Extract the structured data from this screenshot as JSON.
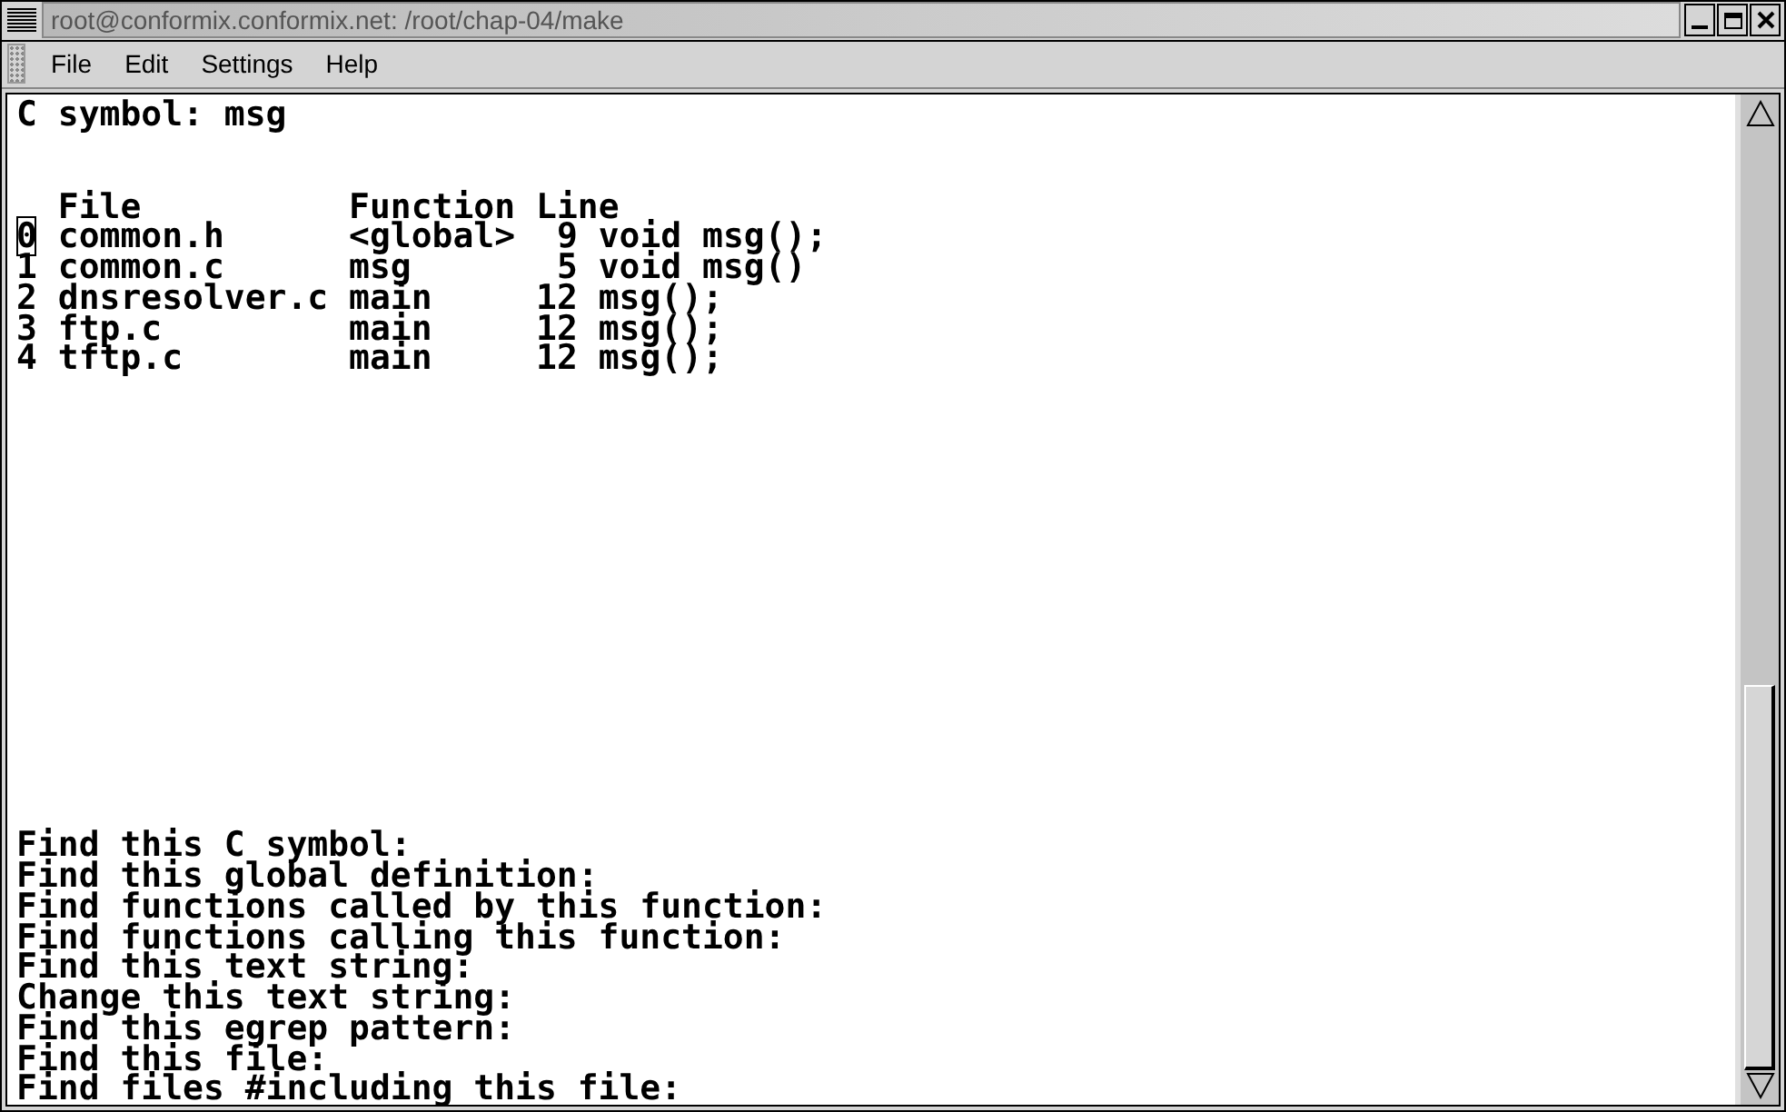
{
  "window": {
    "title": "root@conformix.conformix.net: /root/chap-04/make"
  },
  "menu": [
    "File",
    "Edit",
    "Settings",
    "Help"
  ],
  "terminal": {
    "symbol_line": "C symbol: msg",
    "columns": [
      "File",
      "Function",
      "Line"
    ],
    "results": [
      {
        "index": "0",
        "file": "common.h",
        "function": "<global>",
        "line": "9",
        "context": "void msg();",
        "cursor": true
      },
      {
        "index": "1",
        "file": "common.c",
        "function": "msg",
        "line": "5",
        "context": "void msg()",
        "cursor": false
      },
      {
        "index": "2",
        "file": "dnsresolver.c",
        "function": "main",
        "line": "12",
        "context": "msg();",
        "cursor": false
      },
      {
        "index": "3",
        "file": "ftp.c",
        "function": "main",
        "line": "12",
        "context": "msg();",
        "cursor": false
      },
      {
        "index": "4",
        "file": "tftp.c",
        "function": "main",
        "line": "12",
        "context": "msg();",
        "cursor": false
      }
    ],
    "prompts": [
      "Find this C symbol:",
      "Find this global definition:",
      "Find functions called by this function:",
      "Find functions calling this function:",
      "Find this text string:",
      "Change this text string:",
      "Find this egrep pattern:",
      "Find this file:",
      "Find files #including this file:"
    ]
  }
}
